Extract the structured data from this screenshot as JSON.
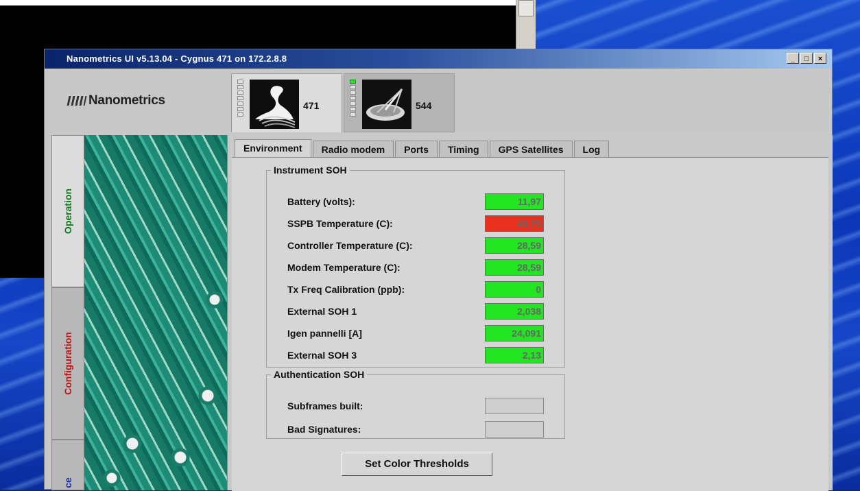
{
  "window": {
    "title": "Nanometrics UI v5.13.04 - Cygnus 471 on 172.2.8.8",
    "controls": [
      "_",
      "□",
      "×"
    ]
  },
  "logo": {
    "text": "Nanometrics"
  },
  "stations": [
    {
      "id": "471",
      "icon": "swan-icon",
      "active": true
    },
    {
      "id": "544",
      "icon": "satellite-dish-icon",
      "active": false
    }
  ],
  "side_tabs": [
    {
      "label": "Operation",
      "color": "#0a7a1a",
      "active": true
    },
    {
      "label": "Configuration",
      "color": "#c41010",
      "active": false
    },
    {
      "label": "ce",
      "color": "#1a2ab0",
      "active": false
    }
  ],
  "tabs": [
    "Environment",
    "Radio modem",
    "Ports",
    "Timing",
    "GPS Satellites",
    "Log"
  ],
  "active_tab": "Environment",
  "instrument_soh": {
    "title": "Instrument SOH",
    "rows": [
      {
        "label": "Battery (volts):",
        "value": "11,97",
        "status": "green"
      },
      {
        "label": "SSPB Temperature (C):",
        "value": "49,75",
        "status": "red"
      },
      {
        "label": "Controller Temperature (C):",
        "value": "28,59",
        "status": "green"
      },
      {
        "label": "Modem Temperature (C):",
        "value": "28,59",
        "status": "green"
      },
      {
        "label": "Tx Freq Calibration (ppb):",
        "value": "0",
        "status": "green"
      },
      {
        "label": "External SOH 1",
        "value": "2,038",
        "status": "green"
      },
      {
        "label": "Igen pannelli [A]",
        "value": "24,091",
        "status": "green"
      },
      {
        "label": "External SOH 3",
        "value": "2,13",
        "status": "green"
      }
    ]
  },
  "authentication_soh": {
    "title": "Authentication SOH",
    "rows": [
      {
        "label": "Subframes built:",
        "value": ""
      },
      {
        "label": "Bad Signatures:",
        "value": ""
      }
    ]
  },
  "buttons": {
    "set_thresholds": "Set Color Thresholds"
  },
  "colors": {
    "green": "#22e622",
    "red": "#e8301c",
    "title_bar": "#0a246a"
  }
}
